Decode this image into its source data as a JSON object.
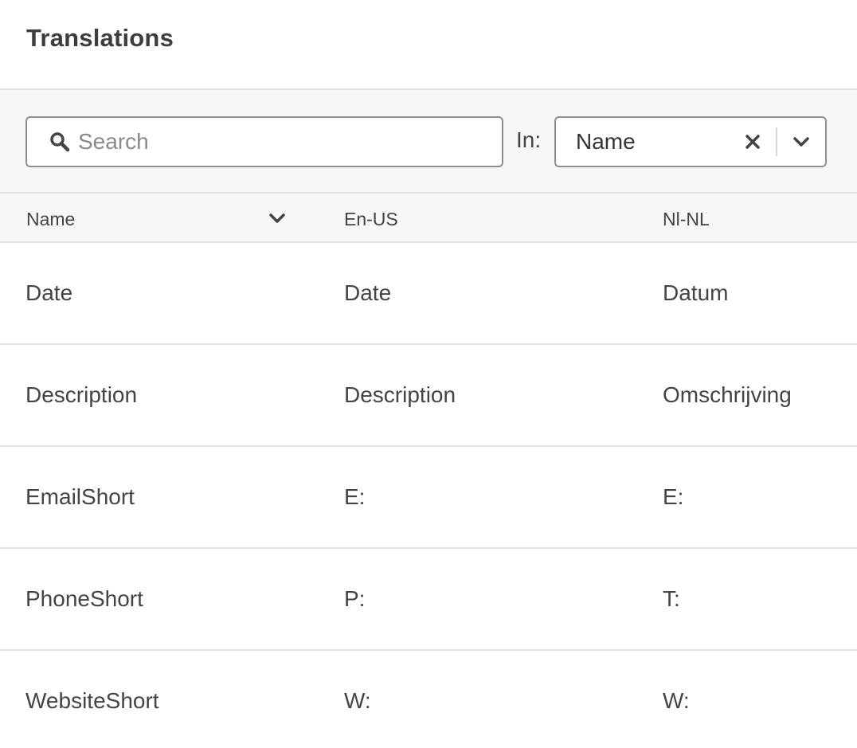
{
  "header": {
    "title": "Translations"
  },
  "toolbar": {
    "search_placeholder": "Search",
    "in_label": "In:",
    "filter_value": "Name"
  },
  "table": {
    "columns": [
      "Name",
      "En-US",
      "Nl-NL"
    ],
    "rows": [
      {
        "name": "Date",
        "en_us": "Date",
        "nl_nl": "Datum"
      },
      {
        "name": "Description",
        "en_us": "Description",
        "nl_nl": "Omschrijving"
      },
      {
        "name": "EmailShort",
        "en_us": "E:",
        "nl_nl": "E:"
      },
      {
        "name": "PhoneShort",
        "en_us": "P:",
        "nl_nl": "T:"
      },
      {
        "name": "WebsiteShort",
        "en_us": "W:",
        "nl_nl": "W:"
      }
    ]
  },
  "icons": {
    "search": "search-icon",
    "clear": "close-icon",
    "dropdown": "chevron-down-icon",
    "sort": "chevron-down-icon"
  },
  "colors": {
    "border": "#8f8f8f",
    "divider": "#e2e2e2",
    "toolbar_bg": "#f7f7f7",
    "text": "#444444"
  }
}
